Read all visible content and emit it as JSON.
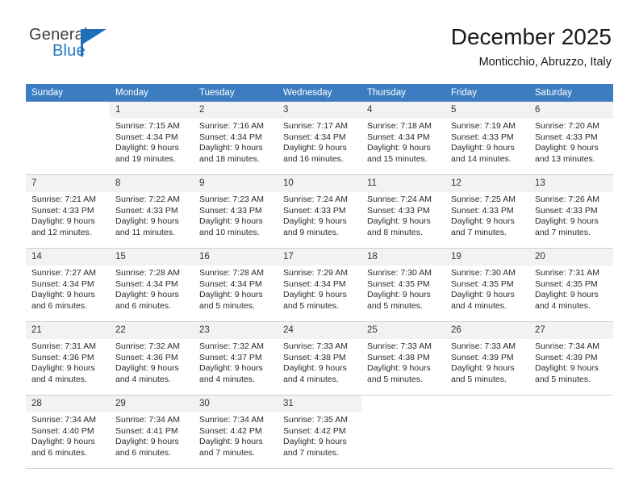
{
  "brand": {
    "name_part1": "General",
    "name_part2": "Blue",
    "flag_icon": "flag-triangle-icon",
    "accent_color": "#1f6fb8"
  },
  "header": {
    "title": "December 2025",
    "subtitle": "Monticchio, Abruzzo, Italy"
  },
  "theme": {
    "header_row_bg": "#3b7dc0",
    "header_row_text": "#ffffff",
    "day_number_bg": "#f2f2f2",
    "row_divider": "#cfcfcf"
  },
  "weekdays": [
    "Sunday",
    "Monday",
    "Tuesday",
    "Wednesday",
    "Thursday",
    "Friday",
    "Saturday"
  ],
  "weeks": [
    [
      {
        "day": "",
        "sunrise": "",
        "sunset": "",
        "daylight1": "",
        "daylight2": ""
      },
      {
        "day": "1",
        "sunrise": "Sunrise: 7:15 AM",
        "sunset": "Sunset: 4:34 PM",
        "daylight1": "Daylight: 9 hours",
        "daylight2": "and 19 minutes."
      },
      {
        "day": "2",
        "sunrise": "Sunrise: 7:16 AM",
        "sunset": "Sunset: 4:34 PM",
        "daylight1": "Daylight: 9 hours",
        "daylight2": "and 18 minutes."
      },
      {
        "day": "3",
        "sunrise": "Sunrise: 7:17 AM",
        "sunset": "Sunset: 4:34 PM",
        "daylight1": "Daylight: 9 hours",
        "daylight2": "and 16 minutes."
      },
      {
        "day": "4",
        "sunrise": "Sunrise: 7:18 AM",
        "sunset": "Sunset: 4:34 PM",
        "daylight1": "Daylight: 9 hours",
        "daylight2": "and 15 minutes."
      },
      {
        "day": "5",
        "sunrise": "Sunrise: 7:19 AM",
        "sunset": "Sunset: 4:33 PM",
        "daylight1": "Daylight: 9 hours",
        "daylight2": "and 14 minutes."
      },
      {
        "day": "6",
        "sunrise": "Sunrise: 7:20 AM",
        "sunset": "Sunset: 4:33 PM",
        "daylight1": "Daylight: 9 hours",
        "daylight2": "and 13 minutes."
      }
    ],
    [
      {
        "day": "7",
        "sunrise": "Sunrise: 7:21 AM",
        "sunset": "Sunset: 4:33 PM",
        "daylight1": "Daylight: 9 hours",
        "daylight2": "and 12 minutes."
      },
      {
        "day": "8",
        "sunrise": "Sunrise: 7:22 AM",
        "sunset": "Sunset: 4:33 PM",
        "daylight1": "Daylight: 9 hours",
        "daylight2": "and 11 minutes."
      },
      {
        "day": "9",
        "sunrise": "Sunrise: 7:23 AM",
        "sunset": "Sunset: 4:33 PM",
        "daylight1": "Daylight: 9 hours",
        "daylight2": "and 10 minutes."
      },
      {
        "day": "10",
        "sunrise": "Sunrise: 7:24 AM",
        "sunset": "Sunset: 4:33 PM",
        "daylight1": "Daylight: 9 hours",
        "daylight2": "and 9 minutes."
      },
      {
        "day": "11",
        "sunrise": "Sunrise: 7:24 AM",
        "sunset": "Sunset: 4:33 PM",
        "daylight1": "Daylight: 9 hours",
        "daylight2": "and 8 minutes."
      },
      {
        "day": "12",
        "sunrise": "Sunrise: 7:25 AM",
        "sunset": "Sunset: 4:33 PM",
        "daylight1": "Daylight: 9 hours",
        "daylight2": "and 7 minutes."
      },
      {
        "day": "13",
        "sunrise": "Sunrise: 7:26 AM",
        "sunset": "Sunset: 4:33 PM",
        "daylight1": "Daylight: 9 hours",
        "daylight2": "and 7 minutes."
      }
    ],
    [
      {
        "day": "14",
        "sunrise": "Sunrise: 7:27 AM",
        "sunset": "Sunset: 4:34 PM",
        "daylight1": "Daylight: 9 hours",
        "daylight2": "and 6 minutes."
      },
      {
        "day": "15",
        "sunrise": "Sunrise: 7:28 AM",
        "sunset": "Sunset: 4:34 PM",
        "daylight1": "Daylight: 9 hours",
        "daylight2": "and 6 minutes."
      },
      {
        "day": "16",
        "sunrise": "Sunrise: 7:28 AM",
        "sunset": "Sunset: 4:34 PM",
        "daylight1": "Daylight: 9 hours",
        "daylight2": "and 5 minutes."
      },
      {
        "day": "17",
        "sunrise": "Sunrise: 7:29 AM",
        "sunset": "Sunset: 4:34 PM",
        "daylight1": "Daylight: 9 hours",
        "daylight2": "and 5 minutes."
      },
      {
        "day": "18",
        "sunrise": "Sunrise: 7:30 AM",
        "sunset": "Sunset: 4:35 PM",
        "daylight1": "Daylight: 9 hours",
        "daylight2": "and 5 minutes."
      },
      {
        "day": "19",
        "sunrise": "Sunrise: 7:30 AM",
        "sunset": "Sunset: 4:35 PM",
        "daylight1": "Daylight: 9 hours",
        "daylight2": "and 4 minutes."
      },
      {
        "day": "20",
        "sunrise": "Sunrise: 7:31 AM",
        "sunset": "Sunset: 4:35 PM",
        "daylight1": "Daylight: 9 hours",
        "daylight2": "and 4 minutes."
      }
    ],
    [
      {
        "day": "21",
        "sunrise": "Sunrise: 7:31 AM",
        "sunset": "Sunset: 4:36 PM",
        "daylight1": "Daylight: 9 hours",
        "daylight2": "and 4 minutes."
      },
      {
        "day": "22",
        "sunrise": "Sunrise: 7:32 AM",
        "sunset": "Sunset: 4:36 PM",
        "daylight1": "Daylight: 9 hours",
        "daylight2": "and 4 minutes."
      },
      {
        "day": "23",
        "sunrise": "Sunrise: 7:32 AM",
        "sunset": "Sunset: 4:37 PM",
        "daylight1": "Daylight: 9 hours",
        "daylight2": "and 4 minutes."
      },
      {
        "day": "24",
        "sunrise": "Sunrise: 7:33 AM",
        "sunset": "Sunset: 4:38 PM",
        "daylight1": "Daylight: 9 hours",
        "daylight2": "and 4 minutes."
      },
      {
        "day": "25",
        "sunrise": "Sunrise: 7:33 AM",
        "sunset": "Sunset: 4:38 PM",
        "daylight1": "Daylight: 9 hours",
        "daylight2": "and 5 minutes."
      },
      {
        "day": "26",
        "sunrise": "Sunrise: 7:33 AM",
        "sunset": "Sunset: 4:39 PM",
        "daylight1": "Daylight: 9 hours",
        "daylight2": "and 5 minutes."
      },
      {
        "day": "27",
        "sunrise": "Sunrise: 7:34 AM",
        "sunset": "Sunset: 4:39 PM",
        "daylight1": "Daylight: 9 hours",
        "daylight2": "and 5 minutes."
      }
    ],
    [
      {
        "day": "28",
        "sunrise": "Sunrise: 7:34 AM",
        "sunset": "Sunset: 4:40 PM",
        "daylight1": "Daylight: 9 hours",
        "daylight2": "and 6 minutes."
      },
      {
        "day": "29",
        "sunrise": "Sunrise: 7:34 AM",
        "sunset": "Sunset: 4:41 PM",
        "daylight1": "Daylight: 9 hours",
        "daylight2": "and 6 minutes."
      },
      {
        "day": "30",
        "sunrise": "Sunrise: 7:34 AM",
        "sunset": "Sunset: 4:42 PM",
        "daylight1": "Daylight: 9 hours",
        "daylight2": "and 7 minutes."
      },
      {
        "day": "31",
        "sunrise": "Sunrise: 7:35 AM",
        "sunset": "Sunset: 4:42 PM",
        "daylight1": "Daylight: 9 hours",
        "daylight2": "and 7 minutes."
      },
      {
        "day": "",
        "sunrise": "",
        "sunset": "",
        "daylight1": "",
        "daylight2": ""
      },
      {
        "day": "",
        "sunrise": "",
        "sunset": "",
        "daylight1": "",
        "daylight2": ""
      },
      {
        "day": "",
        "sunrise": "",
        "sunset": "",
        "daylight1": "",
        "daylight2": ""
      }
    ]
  ]
}
